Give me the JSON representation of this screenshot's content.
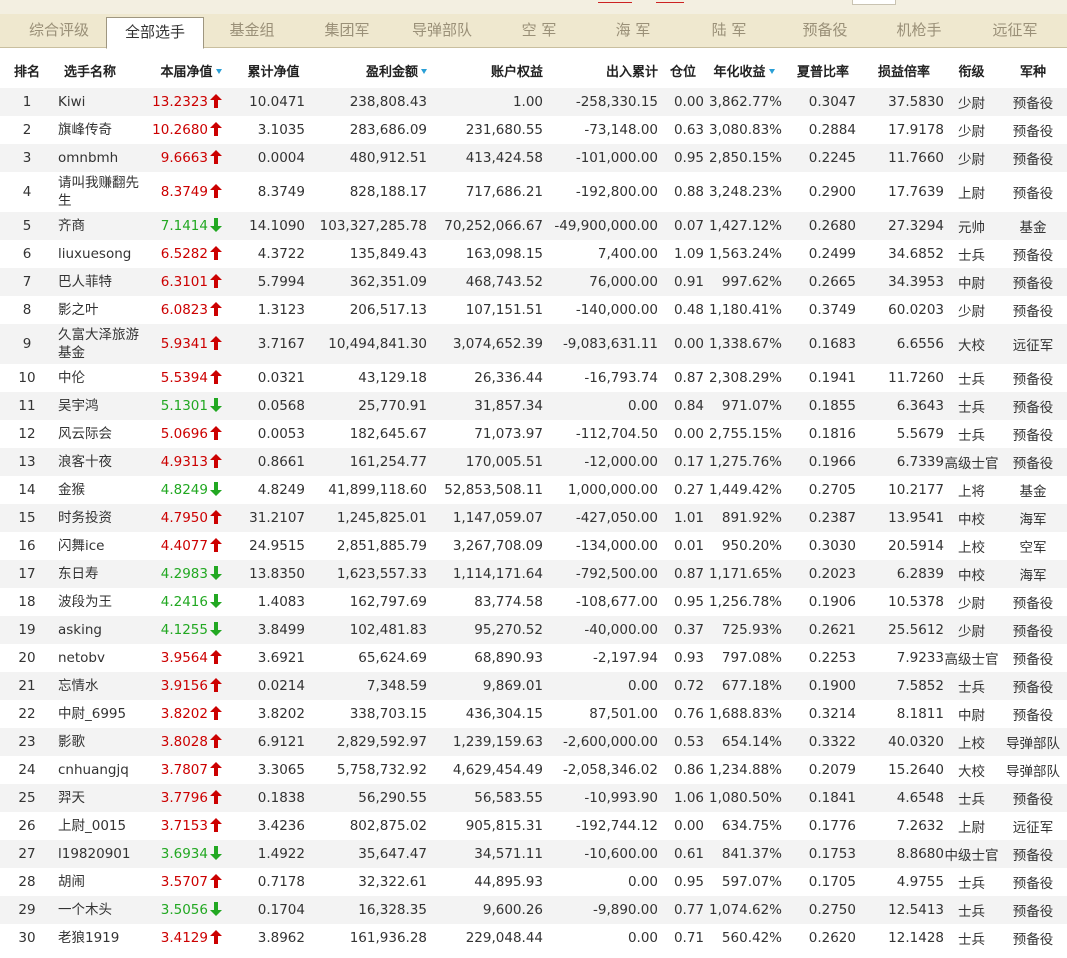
{
  "tabs": [
    {
      "label": "综合评级",
      "active": false
    },
    {
      "label": "全部选手",
      "active": true
    },
    {
      "label": "基金组",
      "active": false
    },
    {
      "label": "集团军",
      "active": false
    },
    {
      "label": "导弹部队",
      "active": false
    },
    {
      "label": "空 军",
      "active": false
    },
    {
      "label": "海 军",
      "active": false
    },
    {
      "label": "陆 军",
      "active": false
    },
    {
      "label": "预备役",
      "active": false
    },
    {
      "label": "机枪手",
      "active": false
    },
    {
      "label": "远征军",
      "active": false
    }
  ],
  "columns": [
    "排名",
    "选手名称",
    "本届净值",
    "累计净值",
    "盈利金额",
    "账户权益",
    "出入累计",
    "仓位",
    "年化收益",
    "夏普比率",
    "损益倍率",
    "衔级",
    "军种"
  ],
  "sorted_columns": [
    "本届净值",
    "盈利金额",
    "年化收益"
  ],
  "colors": {
    "up": "#cc0000",
    "down": "#22a822",
    "sort_indicator": "#2a9fd6",
    "tab_bg": "#efe8cf"
  },
  "icons": {
    "up": "red-up-arrow-icon",
    "down": "green-down-arrow-icon",
    "sort": "sort-desc-icon"
  },
  "rows": [
    {
      "rank": "1",
      "name": "Kiwi",
      "nav": "13.2323",
      "dir": "up",
      "cum": "10.0471",
      "profit": "238,808.43",
      "equity": "1.00",
      "flow": "-258,330.15",
      "pos": "0.00",
      "annual": "3,862.77%",
      "sharpe": "0.3047",
      "ratio": "37.5830",
      "rankTitle": "少尉",
      "branch": "预备役"
    },
    {
      "rank": "2",
      "name": "旗峰传奇",
      "nav": "10.2680",
      "dir": "up",
      "cum": "3.1035",
      "profit": "283,686.09",
      "equity": "231,680.55",
      "flow": "-73,148.00",
      "pos": "0.63",
      "annual": "3,080.83%",
      "sharpe": "0.2884",
      "ratio": "17.9178",
      "rankTitle": "少尉",
      "branch": "预备役"
    },
    {
      "rank": "3",
      "name": "omnbmh",
      "nav": "9.6663",
      "dir": "up",
      "cum": "0.0004",
      "profit": "480,912.51",
      "equity": "413,424.58",
      "flow": "-101,000.00",
      "pos": "0.95",
      "annual": "2,850.15%",
      "sharpe": "0.2245",
      "ratio": "11.7660",
      "rankTitle": "少尉",
      "branch": "预备役"
    },
    {
      "rank": "4",
      "name": "请叫我赚翻先生",
      "nav": "8.3749",
      "dir": "up",
      "cum": "8.3749",
      "profit": "828,188.17",
      "equity": "717,686.21",
      "flow": "-192,800.00",
      "pos": "0.88",
      "annual": "3,248.23%",
      "sharpe": "0.2900",
      "ratio": "17.7639",
      "rankTitle": "上尉",
      "branch": "预备役",
      "tall": true
    },
    {
      "rank": "5",
      "name": "齐商",
      "nav": "7.1414",
      "dir": "down",
      "cum": "14.1090",
      "profit": "103,327,285.78",
      "equity": "70,252,066.67",
      "flow": "-49,900,000.00",
      "pos": "0.07",
      "annual": "1,427.12%",
      "sharpe": "0.2680",
      "ratio": "27.3294",
      "rankTitle": "元帅",
      "branch": "基金"
    },
    {
      "rank": "6",
      "name": "liuxuesong",
      "nav": "6.5282",
      "dir": "up",
      "cum": "4.3722",
      "profit": "135,849.43",
      "equity": "163,098.15",
      "flow": "7,400.00",
      "pos": "1.09",
      "annual": "1,563.24%",
      "sharpe": "0.2499",
      "ratio": "34.6852",
      "rankTitle": "士兵",
      "branch": "预备役"
    },
    {
      "rank": "7",
      "name": "巴人菲特",
      "nav": "6.3101",
      "dir": "up",
      "cum": "5.7994",
      "profit": "362,351.09",
      "equity": "468,743.52",
      "flow": "76,000.00",
      "pos": "0.91",
      "annual": "997.62%",
      "sharpe": "0.2665",
      "ratio": "34.3953",
      "rankTitle": "中尉",
      "branch": "预备役"
    },
    {
      "rank": "8",
      "name": "影之叶",
      "nav": "6.0823",
      "dir": "up",
      "cum": "1.3123",
      "profit": "206,517.13",
      "equity": "107,151.51",
      "flow": "-140,000.00",
      "pos": "0.48",
      "annual": "1,180.41%",
      "sharpe": "0.3749",
      "ratio": "60.0203",
      "rankTitle": "少尉",
      "branch": "预备役"
    },
    {
      "rank": "9",
      "name": "久富大泽旅游基金",
      "nav": "5.9341",
      "dir": "up",
      "cum": "3.7167",
      "profit": "10,494,841.30",
      "equity": "3,074,652.39",
      "flow": "-9,083,631.11",
      "pos": "0.00",
      "annual": "1,338.67%",
      "sharpe": "0.1683",
      "ratio": "6.6556",
      "rankTitle": "大校",
      "branch": "远征军",
      "tall": true
    },
    {
      "rank": "10",
      "name": "中伦",
      "nav": "5.5394",
      "dir": "up",
      "cum": "0.0321",
      "profit": "43,129.18",
      "equity": "26,336.44",
      "flow": "-16,793.74",
      "pos": "0.87",
      "annual": "2,308.29%",
      "sharpe": "0.1941",
      "ratio": "11.7260",
      "rankTitle": "士兵",
      "branch": "预备役"
    },
    {
      "rank": "11",
      "name": "吴宇鸿",
      "nav": "5.1301",
      "dir": "down",
      "cum": "0.0568",
      "profit": "25,770.91",
      "equity": "31,857.34",
      "flow": "0.00",
      "pos": "0.84",
      "annual": "971.07%",
      "sharpe": "0.1855",
      "ratio": "6.3643",
      "rankTitle": "士兵",
      "branch": "预备役"
    },
    {
      "rank": "12",
      "name": "风云际会",
      "nav": "5.0696",
      "dir": "up",
      "cum": "0.0053",
      "profit": "182,645.67",
      "equity": "71,073.97",
      "flow": "-112,704.50",
      "pos": "0.00",
      "annual": "2,755.15%",
      "sharpe": "0.1816",
      "ratio": "5.5679",
      "rankTitle": "士兵",
      "branch": "预备役"
    },
    {
      "rank": "13",
      "name": "浪客十夜",
      "nav": "4.9313",
      "dir": "up",
      "cum": "0.8661",
      "profit": "161,254.77",
      "equity": "170,005.51",
      "flow": "-12,000.00",
      "pos": "0.17",
      "annual": "1,275.76%",
      "sharpe": "0.1966",
      "ratio": "6.7339",
      "rankTitle": "高级士官",
      "branch": "预备役"
    },
    {
      "rank": "14",
      "name": "金猴",
      "nav": "4.8249",
      "dir": "down",
      "cum": "4.8249",
      "profit": "41,899,118.60",
      "equity": "52,853,508.11",
      "flow": "1,000,000.00",
      "pos": "0.27",
      "annual": "1,449.42%",
      "sharpe": "0.2705",
      "ratio": "10.2177",
      "rankTitle": "上将",
      "branch": "基金"
    },
    {
      "rank": "15",
      "name": "时务投资",
      "nav": "4.7950",
      "dir": "up",
      "cum": "31.2107",
      "profit": "1,245,825.01",
      "equity": "1,147,059.07",
      "flow": "-427,050.00",
      "pos": "1.01",
      "annual": "891.92%",
      "sharpe": "0.2387",
      "ratio": "13.9541",
      "rankTitle": "中校",
      "branch": "海军"
    },
    {
      "rank": "16",
      "name": "闪舞ice",
      "nav": "4.4077",
      "dir": "up",
      "cum": "24.9515",
      "profit": "2,851,885.79",
      "equity": "3,267,708.09",
      "flow": "-134,000.00",
      "pos": "0.01",
      "annual": "950.20%",
      "sharpe": "0.3030",
      "ratio": "20.5914",
      "rankTitle": "上校",
      "branch": "空军"
    },
    {
      "rank": "17",
      "name": "东日寿",
      "nav": "4.2983",
      "dir": "down",
      "cum": "13.8350",
      "profit": "1,623,557.33",
      "equity": "1,114,171.64",
      "flow": "-792,500.00",
      "pos": "0.87",
      "annual": "1,171.65%",
      "sharpe": "0.2023",
      "ratio": "6.2839",
      "rankTitle": "中校",
      "branch": "海军"
    },
    {
      "rank": "18",
      "name": "波段为王",
      "nav": "4.2416",
      "dir": "down",
      "cum": "1.4083",
      "profit": "162,797.69",
      "equity": "83,774.58",
      "flow": "-108,677.00",
      "pos": "0.95",
      "annual": "1,256.78%",
      "sharpe": "0.1906",
      "ratio": "10.5378",
      "rankTitle": "少尉",
      "branch": "预备役"
    },
    {
      "rank": "19",
      "name": "asking",
      "nav": "4.1255",
      "dir": "down",
      "cum": "3.8499",
      "profit": "102,481.83",
      "equity": "95,270.52",
      "flow": "-40,000.00",
      "pos": "0.37",
      "annual": "725.93%",
      "sharpe": "0.2621",
      "ratio": "25.5612",
      "rankTitle": "少尉",
      "branch": "预备役"
    },
    {
      "rank": "20",
      "name": "netobv",
      "nav": "3.9564",
      "dir": "up",
      "cum": "3.6921",
      "profit": "65,624.69",
      "equity": "68,890.93",
      "flow": "-2,197.94",
      "pos": "0.93",
      "annual": "797.08%",
      "sharpe": "0.2253",
      "ratio": "7.9233",
      "rankTitle": "高级士官",
      "branch": "预备役"
    },
    {
      "rank": "21",
      "name": "忘情水",
      "nav": "3.9156",
      "dir": "up",
      "cum": "0.0214",
      "profit": "7,348.59",
      "equity": "9,869.01",
      "flow": "0.00",
      "pos": "0.72",
      "annual": "677.18%",
      "sharpe": "0.1900",
      "ratio": "7.5852",
      "rankTitle": "士兵",
      "branch": "预备役"
    },
    {
      "rank": "22",
      "name": "中尉_6995",
      "nav": "3.8202",
      "dir": "up",
      "cum": "3.8202",
      "profit": "338,703.15",
      "equity": "436,304.15",
      "flow": "87,501.00",
      "pos": "0.76",
      "annual": "1,688.83%",
      "sharpe": "0.3214",
      "ratio": "8.1811",
      "rankTitle": "中尉",
      "branch": "预备役"
    },
    {
      "rank": "23",
      "name": "影歌",
      "nav": "3.8028",
      "dir": "up",
      "cum": "6.9121",
      "profit": "2,829,592.97",
      "equity": "1,239,159.63",
      "flow": "-2,600,000.00",
      "pos": "0.53",
      "annual": "654.14%",
      "sharpe": "0.3322",
      "ratio": "40.0320",
      "rankTitle": "上校",
      "branch": "导弹部队"
    },
    {
      "rank": "24",
      "name": "cnhuangjq",
      "nav": "3.7807",
      "dir": "up",
      "cum": "3.3065",
      "profit": "5,758,732.92",
      "equity": "4,629,454.49",
      "flow": "-2,058,346.02",
      "pos": "0.86",
      "annual": "1,234.88%",
      "sharpe": "0.2079",
      "ratio": "15.2640",
      "rankTitle": "大校",
      "branch": "导弹部队"
    },
    {
      "rank": "25",
      "name": "羿天",
      "nav": "3.7796",
      "dir": "up",
      "cum": "0.1838",
      "profit": "56,290.55",
      "equity": "56,583.55",
      "flow": "-10,993.90",
      "pos": "1.06",
      "annual": "1,080.50%",
      "sharpe": "0.1841",
      "ratio": "4.6548",
      "rankTitle": "士兵",
      "branch": "预备役"
    },
    {
      "rank": "26",
      "name": "上尉_0015",
      "nav": "3.7153",
      "dir": "up",
      "cum": "3.4236",
      "profit": "802,875.02",
      "equity": "905,815.31",
      "flow": "-192,744.12",
      "pos": "0.00",
      "annual": "634.75%",
      "sharpe": "0.1776",
      "ratio": "7.2632",
      "rankTitle": "上尉",
      "branch": "远征军"
    },
    {
      "rank": "27",
      "name": "l19820901",
      "nav": "3.6934",
      "dir": "down",
      "cum": "1.4922",
      "profit": "35,647.47",
      "equity": "34,571.11",
      "flow": "-10,600.00",
      "pos": "0.61",
      "annual": "841.37%",
      "sharpe": "0.1753",
      "ratio": "8.8680",
      "rankTitle": "中级士官",
      "branch": "预备役"
    },
    {
      "rank": "28",
      "name": "胡闹",
      "nav": "3.5707",
      "dir": "up",
      "cum": "0.7178",
      "profit": "32,322.61",
      "equity": "44,895.93",
      "flow": "0.00",
      "pos": "0.95",
      "annual": "597.07%",
      "sharpe": "0.1705",
      "ratio": "4.9755",
      "rankTitle": "士兵",
      "branch": "预备役"
    },
    {
      "rank": "29",
      "name": "一个木头",
      "nav": "3.5056",
      "dir": "down",
      "cum": "0.1704",
      "profit": "16,328.35",
      "equity": "9,600.26",
      "flow": "-9,890.00",
      "pos": "0.77",
      "annual": "1,074.62%",
      "sharpe": "0.2750",
      "ratio": "12.5413",
      "rankTitle": "士兵",
      "branch": "预备役"
    },
    {
      "rank": "30",
      "name": "老狼1919",
      "nav": "3.4129",
      "dir": "up",
      "cum": "3.8962",
      "profit": "161,936.28",
      "equity": "229,048.44",
      "flow": "0.00",
      "pos": "0.71",
      "annual": "560.42%",
      "sharpe": "0.2620",
      "ratio": "12.1428",
      "rankTitle": "士兵",
      "branch": "预备役"
    }
  ]
}
